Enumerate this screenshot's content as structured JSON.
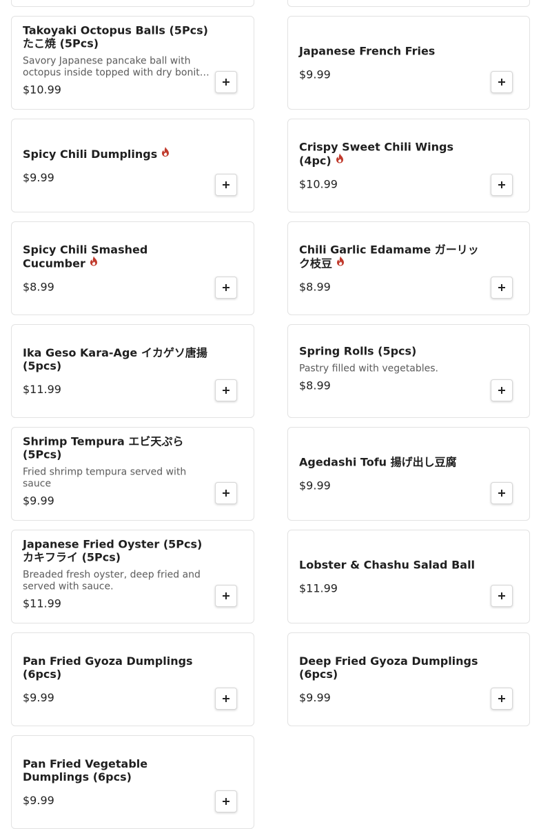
{
  "menu": {
    "add_label": "+",
    "spicy_icon_color": "#c0392b",
    "items": [
      {
        "name": "",
        "price": "",
        "desc": "",
        "spicy": false
      },
      {
        "name": "",
        "price": "",
        "desc": "",
        "spicy": false
      },
      {
        "name": "Takoyaki Octopus Balls (5Pcs) たこ焼 (5Pcs)",
        "desc": "Savory Japanese pancake ball with octopus inside topped with dry bonito flakes, nori, mayonnaise and sauce.",
        "price": "$10.99",
        "spicy": false
      },
      {
        "name": "Japanese French Fries",
        "desc": "",
        "price": "$9.99",
        "spicy": false
      },
      {
        "name": "Spicy Chili Dumplings",
        "desc": "",
        "price": "$9.99",
        "spicy": true
      },
      {
        "name": "Crispy Sweet Chili Wings (4pc)",
        "desc": "",
        "price": "$10.99",
        "spicy": true
      },
      {
        "name": "Spicy Chili Smashed Cucumber",
        "desc": "",
        "price": "$8.99",
        "spicy": true
      },
      {
        "name": "Chili Garlic Edamame ガーリック枝豆",
        "desc": "",
        "price": "$8.99",
        "spicy": true
      },
      {
        "name": "Ika Geso Kara-Age イカゲソ唐揚 (5pcs)",
        "desc": "",
        "price": "$11.99",
        "spicy": false
      },
      {
        "name": "Spring Rolls (5pcs)",
        "desc": "Pastry filled with vegetables.",
        "price": "$8.99",
        "spicy": false
      },
      {
        "name": "Shrimp Tempura エビ天ぷら (5Pcs)",
        "desc": "Fried shrimp tempura served with sauce",
        "price": "$9.99",
        "spicy": false
      },
      {
        "name": "Agedashi Tofu 揚げ出し豆腐",
        "desc": "",
        "price": "$9.99",
        "spicy": false
      },
      {
        "name": "Japanese Fried Oyster (5Pcs) カキフライ (5Pcs)",
        "desc": "Breaded fresh oyster, deep fried and served with sauce.",
        "price": "$11.99",
        "spicy": false
      },
      {
        "name": "Lobster & Chashu Salad Ball",
        "desc": "",
        "price": "$11.99",
        "spicy": false
      },
      {
        "name": "Pan Fried Gyoza Dumplings (6pcs)",
        "desc": "",
        "price": "$9.99",
        "spicy": false
      },
      {
        "name": "Deep Fried Gyoza Dumplings (6pcs)",
        "desc": "",
        "price": "$9.99",
        "spicy": false
      },
      {
        "name": "Pan Fried Vegetable Dumplings (6pcs)",
        "desc": "",
        "price": "$9.99",
        "spicy": false
      }
    ]
  }
}
